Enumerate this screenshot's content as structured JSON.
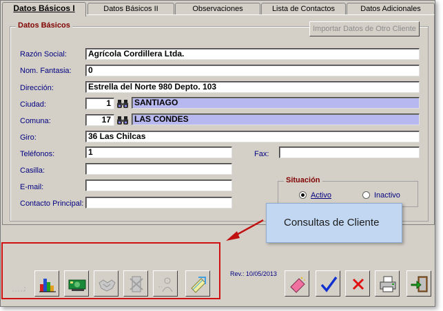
{
  "tabs": [
    {
      "label": "Datos Básicos I",
      "active": true
    },
    {
      "label": "Datos Básicos II",
      "active": false
    },
    {
      "label": "Observaciones",
      "active": false
    },
    {
      "label": "Lista de Contactos",
      "active": false
    },
    {
      "label": "Datos Adicionales",
      "active": false
    }
  ],
  "group_title": "Datos Básicos",
  "import_button": "Importar Datos de Otro Cliente",
  "fields": {
    "razon_social": {
      "label": "Razón Social:",
      "value": "Agrícola Cordillera Ltda."
    },
    "nom_fantasia": {
      "label": "Nom. Fantasia:",
      "value": "0"
    },
    "direccion": {
      "label": "Dirección:",
      "value": "Estrella del Norte 980 Depto. 103"
    },
    "ciudad": {
      "label": "Ciudad:",
      "code": "1",
      "name": "SANTIAGO"
    },
    "comuna": {
      "label": "Comuna:",
      "code": "17",
      "name": "LAS CONDES"
    },
    "giro": {
      "label": "Giro:",
      "value": "36 Las Chilcas"
    },
    "telefonos": {
      "label": "Teléfonos:",
      "value": "1"
    },
    "fax": {
      "label": "Fax:",
      "value": ""
    },
    "casilla": {
      "label": "Casilla:",
      "value": ""
    },
    "email": {
      "label": "E-mail:",
      "value": ""
    },
    "contacto": {
      "label": "Contacto Principal:",
      "value": ""
    }
  },
  "situacion": {
    "title": "Situación",
    "options": [
      {
        "label": "Activo",
        "selected": true
      },
      {
        "label": "Inactivo",
        "selected": false
      }
    ]
  },
  "revision": "Rev.: 10/05/2013",
  "callout": "Consultas de Cliente",
  "toolbar": {
    "left_icons": [
      "blank-icon",
      "bar-chart-icon",
      "money-icon",
      "handshake-icon",
      "tools-icon",
      "person-icon",
      "edit-document-icon"
    ],
    "right_icons": [
      "eraser-icon",
      "checkmark-icon",
      "cross-icon",
      "printer-icon",
      "exit-door-icon"
    ]
  },
  "colors": {
    "label": "#000080",
    "group_title": "#800000",
    "readonly_field": "#b8b8f0",
    "callout": "#c2d8f2",
    "highlight_box": "#d01010"
  }
}
